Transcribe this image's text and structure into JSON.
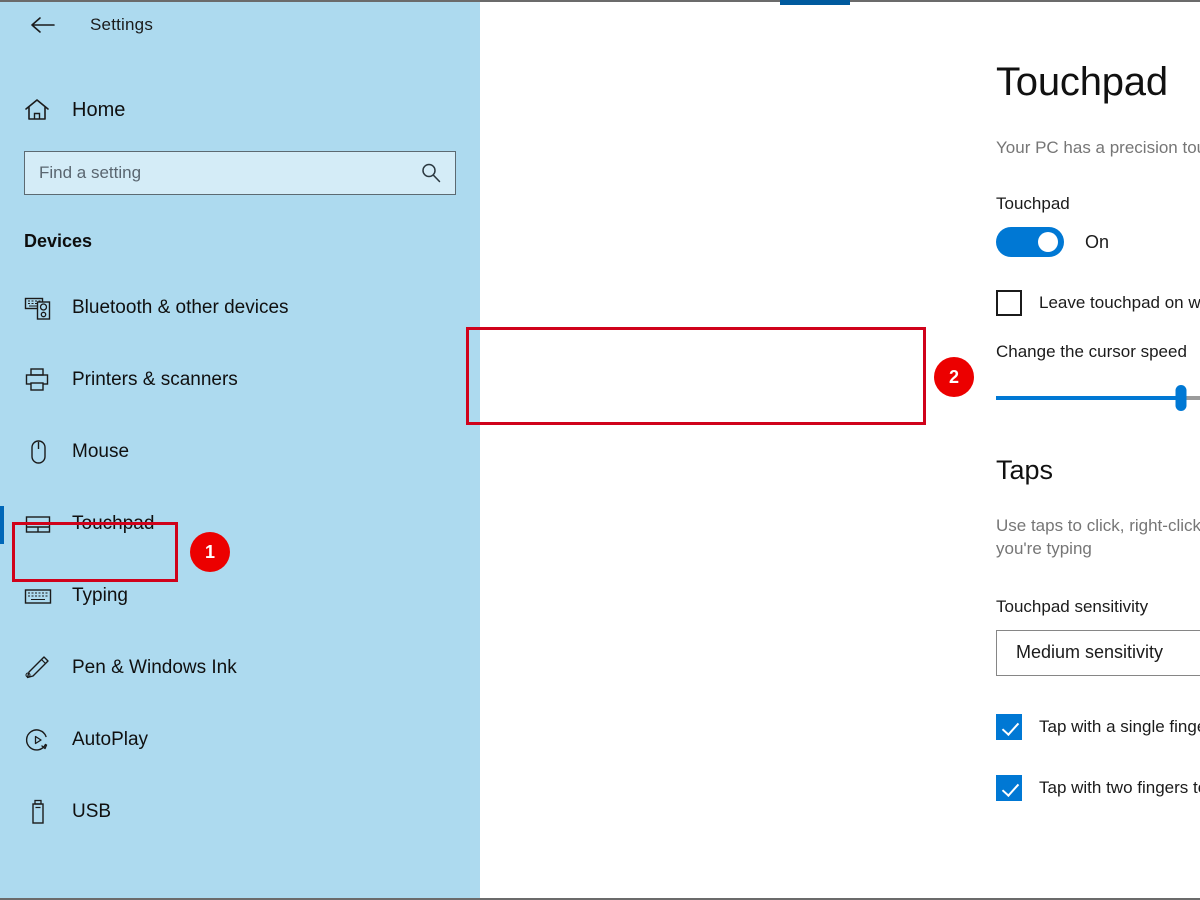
{
  "window": {
    "title": "Settings",
    "back_icon": "back-arrow-icon"
  },
  "sidebar": {
    "background_color": "#ADDAEF",
    "home": {
      "label": "Home",
      "icon": "home-icon"
    },
    "search": {
      "placeholder": "Find a setting",
      "value": "",
      "icon": "search-icon"
    },
    "group_title": "Devices",
    "items": [
      {
        "label": "Bluetooth & other devices",
        "icon": "bluetooth-devices-icon",
        "selected": false
      },
      {
        "label": "Printers & scanners",
        "icon": "printer-icon",
        "selected": false
      },
      {
        "label": "Mouse",
        "icon": "mouse-icon",
        "selected": false
      },
      {
        "label": "Touchpad",
        "icon": "touchpad-icon",
        "selected": true
      },
      {
        "label": "Typing",
        "icon": "keyboard-icon",
        "selected": false
      },
      {
        "label": "Pen & Windows Ink",
        "icon": "pen-icon",
        "selected": false
      },
      {
        "label": "AutoPlay",
        "icon": "autoplay-icon",
        "selected": false
      },
      {
        "label": "USB",
        "icon": "usb-drive-icon",
        "selected": false
      }
    ]
  },
  "main": {
    "page_title": "Touchpad",
    "page_subtitle": "Your PC has a precision touchpad.",
    "touchpad": {
      "label": "Touchpad",
      "toggle_state": "On",
      "toggle_on": true
    },
    "leave_on_checkbox": {
      "label": "Leave touchpad on when a mouse is connected",
      "checked": false
    },
    "cursor_speed": {
      "label": "Change the cursor speed",
      "value_percent": 44
    },
    "taps": {
      "title": "Taps",
      "description": "Use taps to click, right-click, and select. Turn down the sensitivity if they activate while you're typing",
      "sensitivity_label": "Touchpad sensitivity",
      "sensitivity_value": "Medium sensitivity",
      "sensitivity_icon": "chevron-down-icon",
      "checkboxes": [
        {
          "label": "Tap with a single finger to single-click",
          "checked": true
        },
        {
          "label": "Tap with two fingers to right-click",
          "checked": true
        }
      ]
    }
  },
  "annotations": {
    "callout_color": "#EC0000",
    "highlight_color": "#D0021B",
    "badges": [
      {
        "number": "1",
        "target": "sidebar-item-touchpad"
      },
      {
        "number": "2",
        "target": "cursor-speed-section"
      }
    ]
  }
}
